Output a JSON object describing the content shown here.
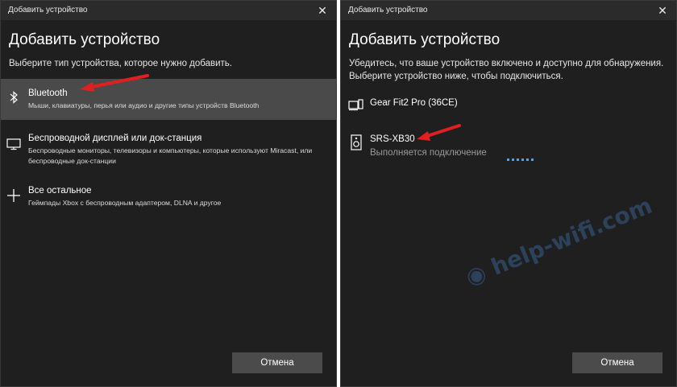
{
  "left_window": {
    "title": "Добавить устройство",
    "heading": "Добавить устройство",
    "subtitle": "Выберите тип устройства, которое нужно добавить.",
    "items": [
      {
        "label": "Bluetooth",
        "description": "Мыши, клавиатуры, перья или аудио и другие типы устройств Bluetooth",
        "icon": "bluetooth-icon",
        "selected": true
      },
      {
        "label": "Беспроводной дисплей или док-станция",
        "description": "Беспроводные мониторы, телевизоры и компьютеры, которые используют Miracast, или беспроводные док-станции",
        "icon": "monitor-icon"
      },
      {
        "label": "Все остальное",
        "description": "Геймпады Xbox с беспроводным адаптером, DLNA и другое",
        "icon": "plus-icon"
      }
    ],
    "cancel_label": "Отмена"
  },
  "right_window": {
    "title": "Добавить устройство",
    "heading": "Добавить устройство",
    "subtitle": "Убедитесь, что ваше устройство включено и доступно для обнаружения. Выберите устройство ниже, чтобы подключиться.",
    "devices": [
      {
        "name": "Gear Fit2 Pro (36CE)",
        "icon": "phone-laptop-icon"
      },
      {
        "name": "SRS-XB30",
        "status": "Выполняется подключение",
        "icon": "speaker-icon"
      }
    ],
    "cancel_label": "Отмена"
  },
  "watermark": "help-wifi.com",
  "colors": {
    "window_bg": "#1f1f1f",
    "selected_bg": "#4a4a4a",
    "button_bg": "#4b4b4b",
    "arrow": "#e02020",
    "progress": "#4aa3ff"
  }
}
